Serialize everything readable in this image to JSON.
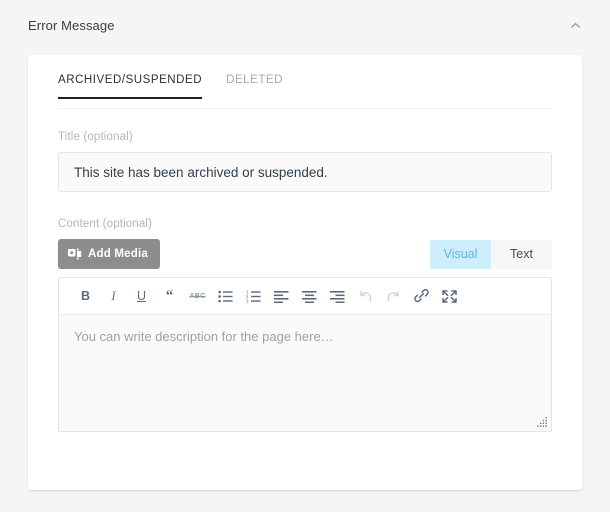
{
  "panel": {
    "title": "Error Message",
    "collapse_icon": "chevron-up-icon"
  },
  "tabs": [
    {
      "label": "ARCHIVED/SUSPENDED",
      "active": true
    },
    {
      "label": "DELETED",
      "active": false
    }
  ],
  "title_field": {
    "label": "Title (optional)",
    "value": "This site has been archived or suspended.",
    "placeholder": ""
  },
  "content_field": {
    "label": "Content (optional)",
    "add_media_label": "Add Media",
    "add_media_icon": "media-icon",
    "editor_modes": [
      {
        "label": "Visual",
        "active": true
      },
      {
        "label": "Text",
        "active": false
      }
    ],
    "editor_placeholder": "You can write description for the page here…",
    "toolbar": [
      {
        "name": "bold-icon",
        "glyph": "B",
        "enabled": true
      },
      {
        "name": "italic-icon",
        "glyph": "I",
        "enabled": true
      },
      {
        "name": "underline-icon",
        "glyph": "U",
        "enabled": true
      },
      {
        "name": "blockquote-icon",
        "glyph": "“",
        "enabled": true
      },
      {
        "name": "strikethrough-icon",
        "glyph": "ABC",
        "enabled": true
      },
      {
        "name": "bulleted-list-icon",
        "glyph": "",
        "enabled": true
      },
      {
        "name": "numbered-list-icon",
        "glyph": "",
        "enabled": true
      },
      {
        "name": "align-left-icon",
        "glyph": "",
        "enabled": true
      },
      {
        "name": "align-center-icon",
        "glyph": "",
        "enabled": true
      },
      {
        "name": "align-right-icon",
        "glyph": "",
        "enabled": true
      },
      {
        "name": "undo-icon",
        "glyph": "",
        "enabled": false
      },
      {
        "name": "redo-icon",
        "glyph": "",
        "enabled": false
      },
      {
        "name": "insert-link-icon",
        "glyph": "",
        "enabled": true
      },
      {
        "name": "fullscreen-icon",
        "glyph": "",
        "enabled": true
      }
    ]
  },
  "colors": {
    "page_background": "#f5f5f5",
    "card_background": "#ffffff",
    "active_tab_underline": "#1f1f1f",
    "add_media_button": "#8d8d8d",
    "visual_tab_background": "#cfeefb",
    "visual_tab_text": "#5eb4e7",
    "label_text": "#b5b5b5",
    "input_text": "#30404d"
  }
}
